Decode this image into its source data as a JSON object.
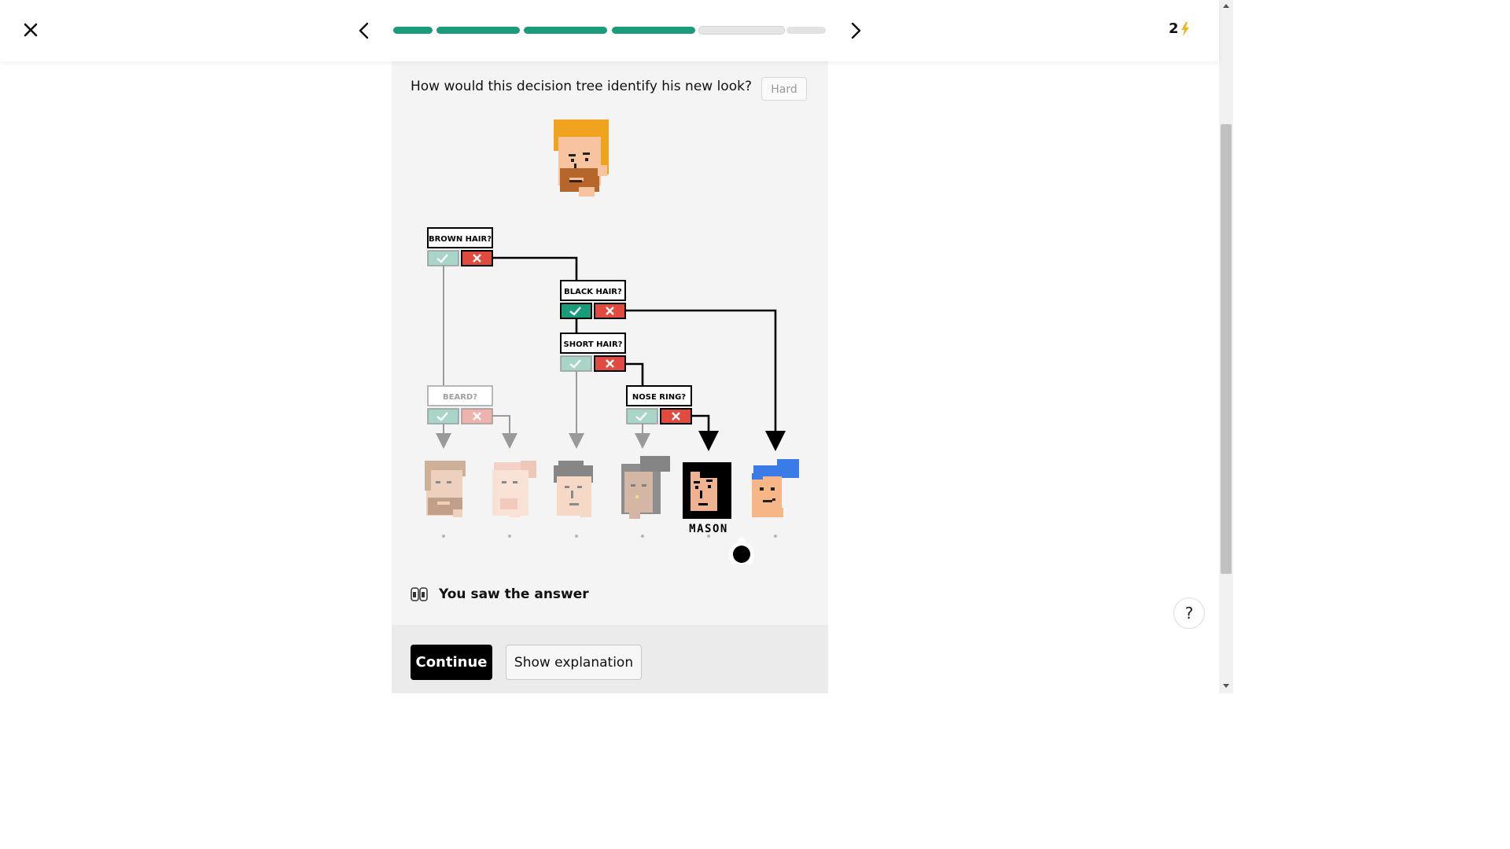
{
  "topbar": {
    "progress_segments": [
      {
        "state": "complete",
        "color": "#1a9b7a"
      },
      {
        "state": "complete",
        "color": "#1a9b7a"
      },
      {
        "state": "complete",
        "color": "#1a9b7a"
      },
      {
        "state": "complete",
        "color": "#1a9b7a"
      },
      {
        "state": "current",
        "color": "#e6e6e6"
      },
      {
        "state": "upcoming",
        "color": "#e2e2e2"
      }
    ],
    "energy_count": "2",
    "energy_icon": "lightning-bolt-icon",
    "energy_color": "#f0b429"
  },
  "question": {
    "text": "How would this decision tree identify his new look?",
    "difficulty": "Hard"
  },
  "tree": {
    "nodes": {
      "brown_hair": "BROWN HAIR?",
      "black_hair": "BLACK HAIR?",
      "short_hair": "SHORT HAIR?",
      "beard": "BEARD?",
      "nose_ring": "NOSE RING?"
    },
    "selected_name": "MASON",
    "colors": {
      "yes": "#1a9b7a",
      "no": "#e04a3f",
      "highlight": "#000000",
      "faded": "#a0a0a0"
    }
  },
  "feedback": {
    "icon": "eyes-icon",
    "text": "You saw the answer"
  },
  "actions": {
    "continue": "Continue",
    "show_explanation": "Show explanation"
  },
  "help": {
    "label": "?"
  }
}
